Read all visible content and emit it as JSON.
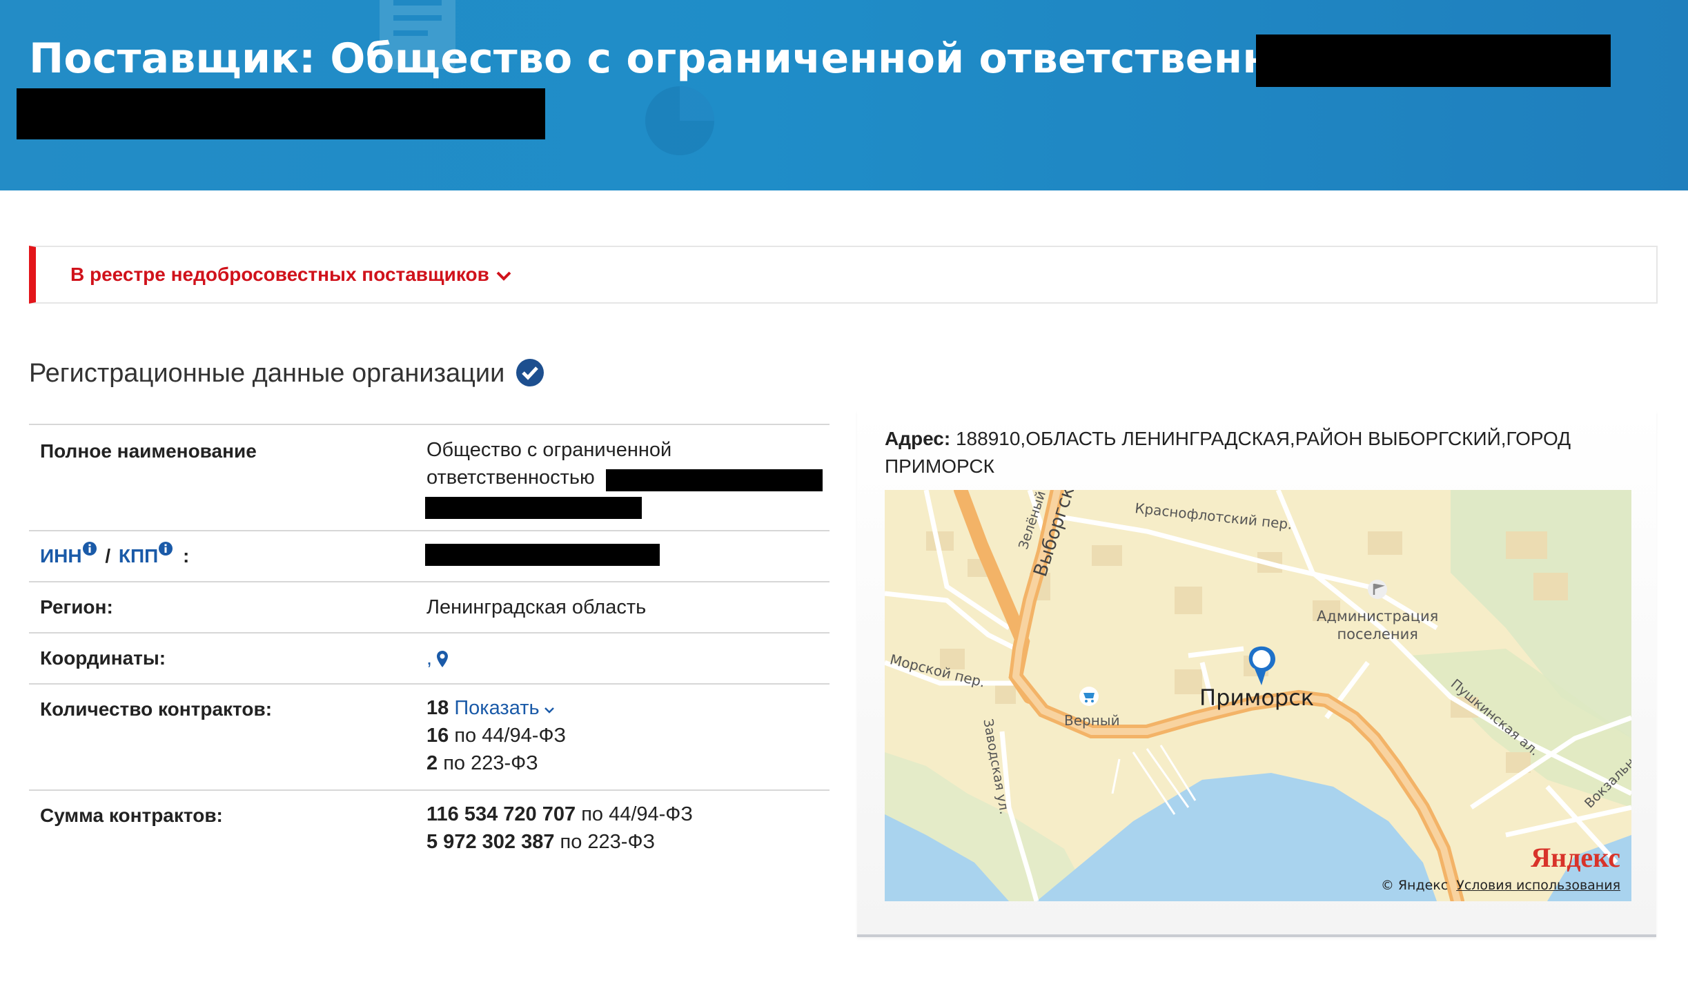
{
  "header": {
    "title": "Поставщик: Общество с ограниченной ответственностью"
  },
  "alert": {
    "label": "В реестре недобросовестных поставщиков",
    "icon": "chevron-down-icon",
    "color": "#d0121b"
  },
  "section": {
    "title": "Регистрационные данные организации",
    "icon": "check-circle-icon"
  },
  "details": {
    "full_name_label": "Полное наименование",
    "full_name_line1": "Общество с ограниченной",
    "full_name_line2": "ответственностью",
    "inn_label": "ИНН",
    "kpp_label": "КПП",
    "inn_sep": "/",
    "inn_colon": ":",
    "region_label": "Регион:",
    "region_value": "Ленинградская область",
    "coords_label": "Координаты:",
    "coords_value": ",",
    "contracts_label": "Количество контрактов:",
    "contracts_total": "18",
    "contracts_show": "Показать",
    "contracts_44_count": "16",
    "contracts_44_suffix": "по 44/94-ФЗ",
    "contracts_223_count": "2",
    "contracts_223_suffix": "по 223-ФЗ",
    "sum_label": "Сумма контрактов:",
    "sum_44_value": "116 534 720 707",
    "sum_44_suffix": "по 44/94-ФЗ",
    "sum_223_value": "5 972 302 387",
    "sum_223_suffix": "по 223-ФЗ"
  },
  "map": {
    "address_label": "Адрес:",
    "address_value": "188910,ОБЛАСТЬ ЛЕНИНГРАДСКАЯ,РАЙОН ВЫБОРГСКИЙ,ГОРОД ПРИМОРСК",
    "labels": {
      "vyborgskoe": "Выборгское ш.",
      "zelenyi": "Зелёный",
      "krasnoflotskiy": "Краснофлотский пер.",
      "administration": "Администрация\nпоселения",
      "morskoy": "Морской пер.",
      "verny": "Верный",
      "primorsk": "Приморск",
      "zavodskaya": "Заводская ул.",
      "pushkinskaya": "Пушкинская ал.",
      "vokzalnaya": "Вокзальн"
    },
    "copyright": "© Яндекс",
    "terms": "Условия использования",
    "logo": "Яндекс"
  },
  "colors": {
    "header_bg": "#1f8dc8",
    "link": "#1a5aa8",
    "alert_border": "#e3151a"
  }
}
